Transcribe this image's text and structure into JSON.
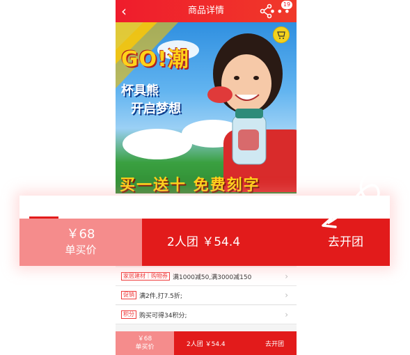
{
  "nav": {
    "title": "商品详情",
    "back": "‹",
    "badge": "19",
    "more": "•••"
  },
  "banner": {
    "headline": "GO!潮",
    "slogan_line1": "杯具熊",
    "slogan_line2": "开启梦想",
    "promo": "买一送十 免费刻字",
    "colors": {
      "sky": "#2f8fe0",
      "grass": "#2f8a33",
      "headline": "#ffd21a"
    }
  },
  "promotions": [
    {
      "tag": "家居建材｜购物券",
      "text": "满1000减50,满3000减150"
    },
    {
      "tag": "促销",
      "text": "满2件,打7.5折;"
    },
    {
      "tag": "积分",
      "text": "购买可得34积分;"
    }
  ],
  "buy_bar": {
    "single_price": "￥68",
    "single_label": "单买价",
    "group_price": "2人团 ￥54.4",
    "group_action": "去开团",
    "colors": {
      "single": "#f58c8c",
      "group": "#e21b1b"
    }
  }
}
